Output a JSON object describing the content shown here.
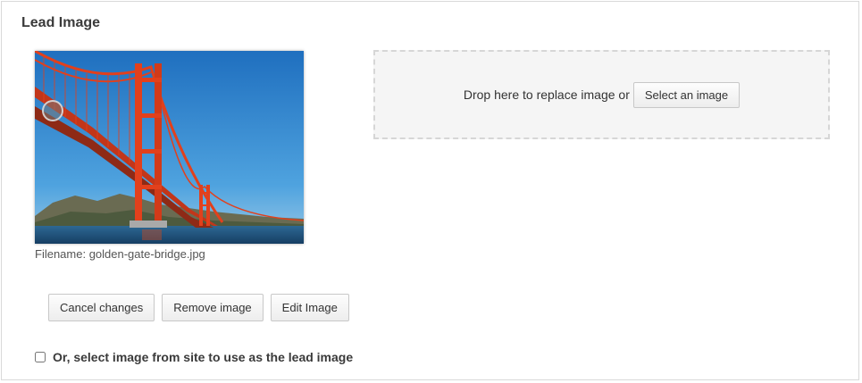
{
  "section": {
    "title": "Lead Image"
  },
  "image": {
    "filename_label": "Filename: golden-gate-bridge.jpg",
    "sky_color": "#2f86c8",
    "bridge_color": "#e2401c",
    "water_color": "#1d4f7a"
  },
  "dropzone": {
    "text": "Drop here to replace image or",
    "select_button": "Select an image"
  },
  "actions": {
    "cancel": "Cancel changes",
    "remove": "Remove image",
    "edit": "Edit Image"
  },
  "site_select": {
    "label": "Or, select image from site to use as the lead image",
    "checked": false
  }
}
